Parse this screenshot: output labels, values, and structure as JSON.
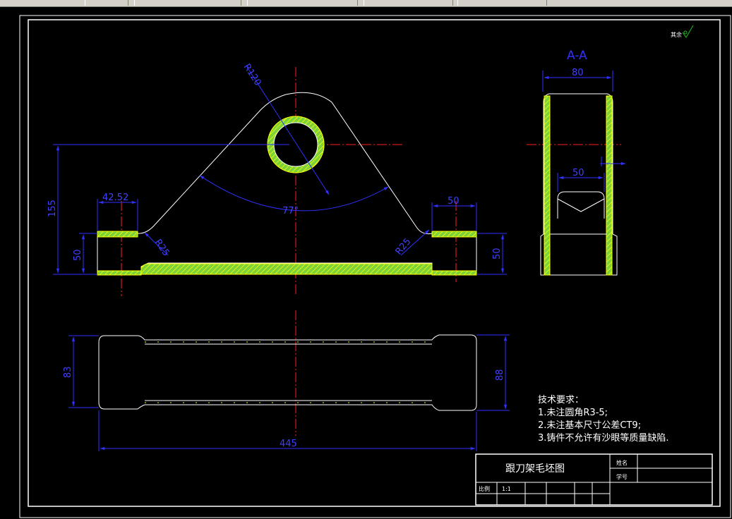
{
  "toolbar": {
    "segments": 8
  },
  "section_label": "A-A",
  "dims": {
    "r120": "R120",
    "w4252": "42.52",
    "h155": "155",
    "h50_left": "50",
    "r25_left": "R25",
    "angle77": "77°",
    "r25_right": "R25",
    "w50_top": "50",
    "h50_right": "50",
    "w80": "80",
    "w50_section": "50",
    "h83": "83",
    "h88": "88",
    "w445": "445"
  },
  "roughness": "其余",
  "notes": {
    "title": "技术要求：",
    "lines": [
      "1.未注圆角R3-5;",
      "2.未注基本尺寸公差CT9;",
      "3.铸件不允许有沙眼等质量缺陷."
    ]
  },
  "title_block": {
    "drawing_name": "跟刀架毛坯图",
    "name_label": "姓名",
    "id_label": "学号",
    "scale_label": "比例",
    "scale_value": "1:1"
  },
  "colors": {
    "background": "#000000",
    "outline": "#ffffff",
    "hatch": "#ffff00",
    "hatch_fill": "#7bd23a",
    "dimension": "#3030ff",
    "centerline": "#ff2020",
    "roughness_mark": "#20c020"
  }
}
